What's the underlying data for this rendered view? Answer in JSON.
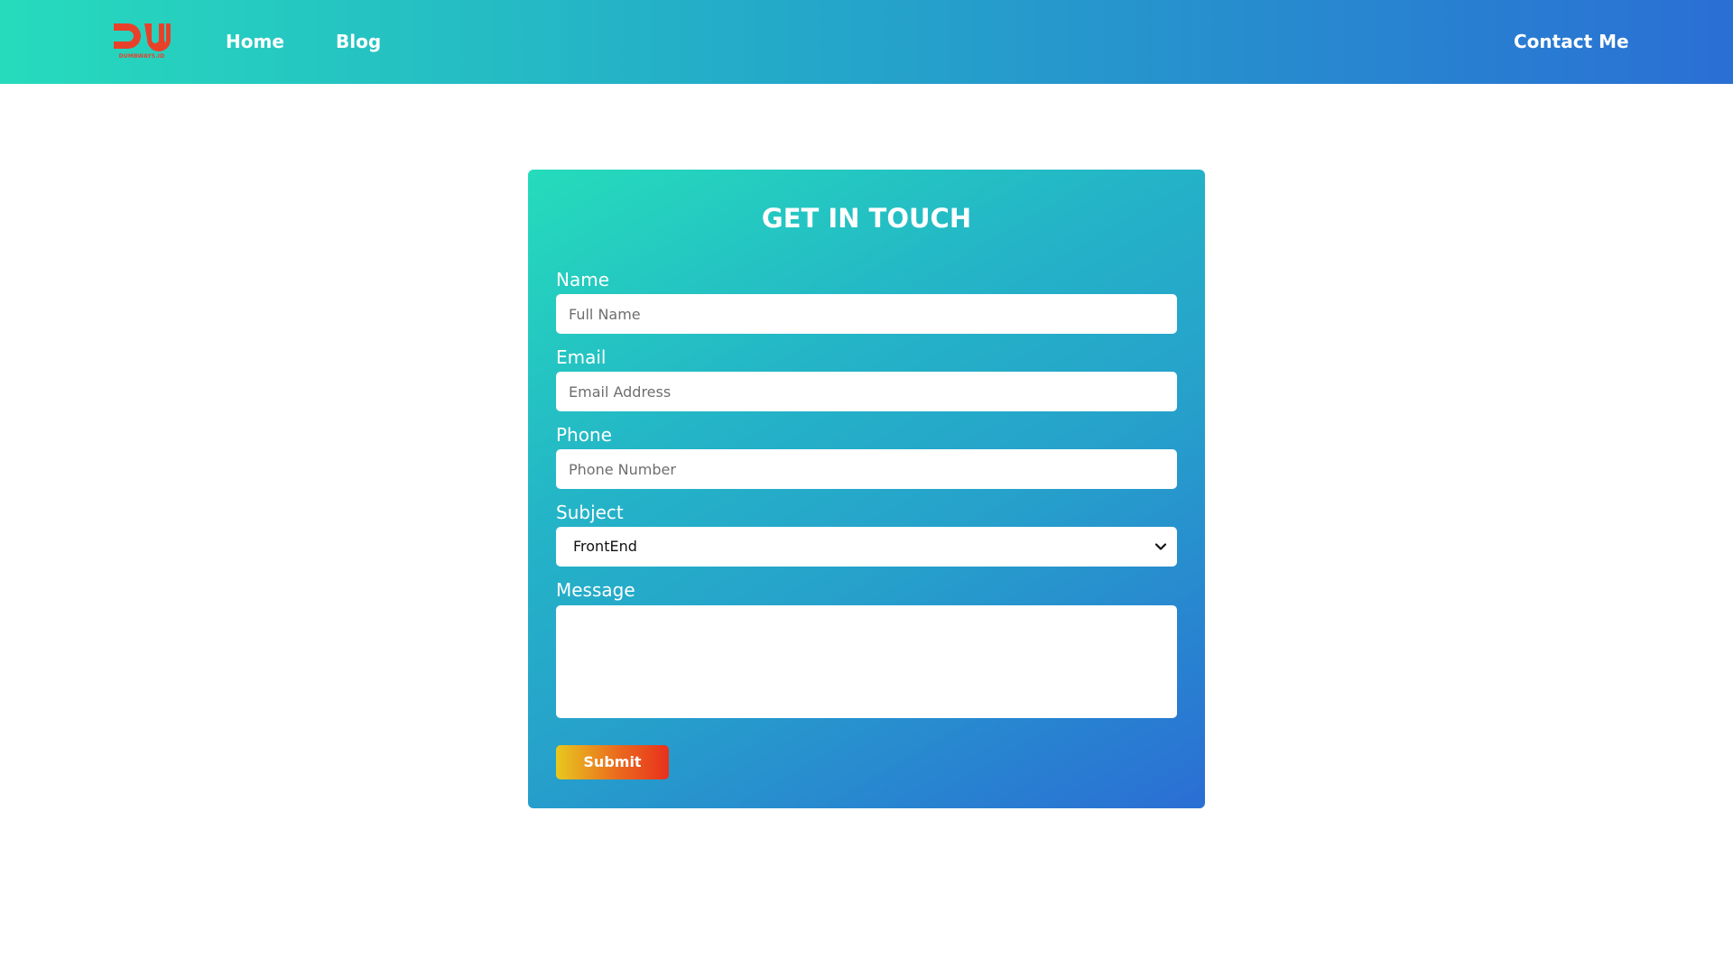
{
  "brand": {
    "logo_text": "DUMBWAYS.ID",
    "logo_color": "#e8412a"
  },
  "nav": {
    "home": "Home",
    "blog": "Blog",
    "contact": "Contact Me"
  },
  "form": {
    "title": "GET IN TOUCH",
    "name_label": "Name",
    "name_placeholder": "Full Name",
    "email_label": "Email",
    "email_placeholder": "Email Address",
    "phone_label": "Phone",
    "phone_placeholder": "Phone Number",
    "subject_label": "Subject",
    "subject_selected": "FrontEnd",
    "message_label": "Message",
    "submit_label": "Submit"
  },
  "colors": {
    "nav_gradient_start": "#26dbbc",
    "nav_gradient_end": "#2a6fd4",
    "submit_gradient_start": "#e8c81e",
    "submit_gradient_end": "#e8311c"
  }
}
